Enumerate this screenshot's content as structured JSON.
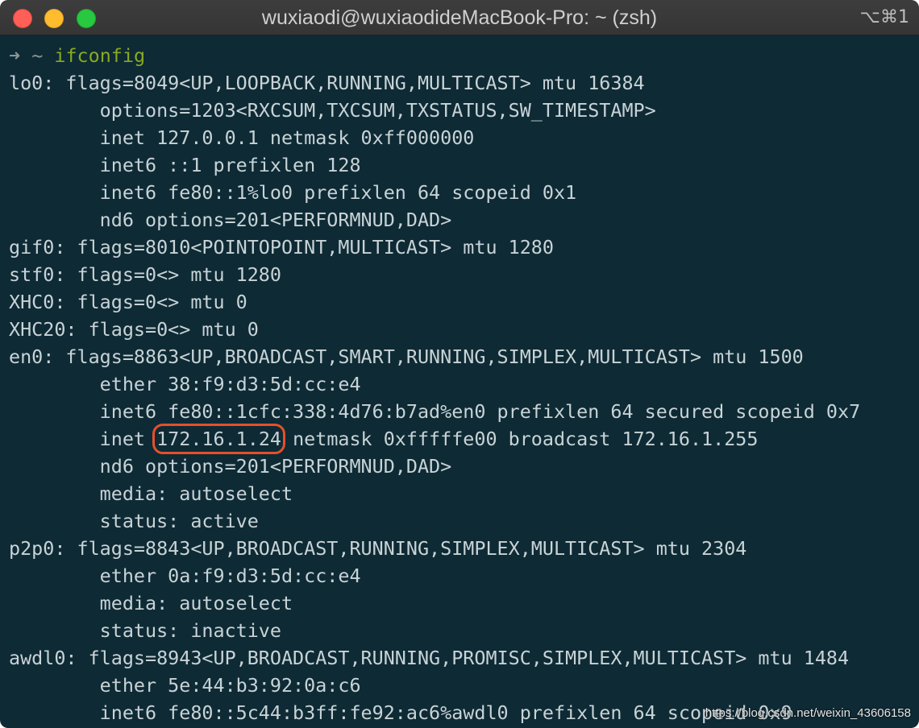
{
  "window": {
    "title": "wuxiaodi@wuxiaodideMacBook-Pro: ~ (zsh)",
    "shortcut": "⌥⌘1"
  },
  "prompt": {
    "arrow": "➜",
    "tilde": "~",
    "command": "ifconfig"
  },
  "output": [
    "lo0: flags=8049<UP,LOOPBACK,RUNNING,MULTICAST> mtu 16384",
    "        options=1203<RXCSUM,TXCSUM,TXSTATUS,SW_TIMESTAMP>",
    "        inet 127.0.0.1 netmask 0xff000000",
    "        inet6 ::1 prefixlen 128",
    "        inet6 fe80::1%lo0 prefixlen 64 scopeid 0x1",
    "        nd6 options=201<PERFORMNUD,DAD>",
    "gif0: flags=8010<POINTOPOINT,MULTICAST> mtu 1280",
    "stf0: flags=0<> mtu 1280",
    "XHC0: flags=0<> mtu 0",
    "XHC20: flags=0<> mtu 0",
    "en0: flags=8863<UP,BROADCAST,SMART,RUNNING,SIMPLEX,MULTICAST> mtu 1500",
    "        ether 38:f9:d3:5d:cc:e4",
    "        inet6 fe80::1cfc:338:4d76:b7ad%en0 prefixlen 64 secured scopeid 0x7"
  ],
  "highlight_line": {
    "prefix": "        inet ",
    "highlighted": "172.16.1.24",
    "suffix": " netmask 0xfffffe00 broadcast 172.16.1.255"
  },
  "output2": [
    "        nd6 options=201<PERFORMNUD,DAD>",
    "        media: autoselect",
    "        status: active",
    "p2p0: flags=8843<UP,BROADCAST,RUNNING,SIMPLEX,MULTICAST> mtu 2304",
    "        ether 0a:f9:d3:5d:cc:e4",
    "        media: autoselect",
    "        status: inactive",
    "awdl0: flags=8943<UP,BROADCAST,RUNNING,PROMISC,SIMPLEX,MULTICAST> mtu 1484",
    "        ether 5e:44:b3:92:0a:c6",
    "        inet6 fe80::5c44:b3ff:fe92:ac6%awdl0 prefixlen 64 scopeid 0x9"
  ],
  "watermark": "https://blog.csdn.net/weixin_43606158",
  "colors": {
    "background": "#0e2a35",
    "text": "#c8d3d6",
    "command": "#88aa20",
    "highlight_box": "#e5502a"
  }
}
